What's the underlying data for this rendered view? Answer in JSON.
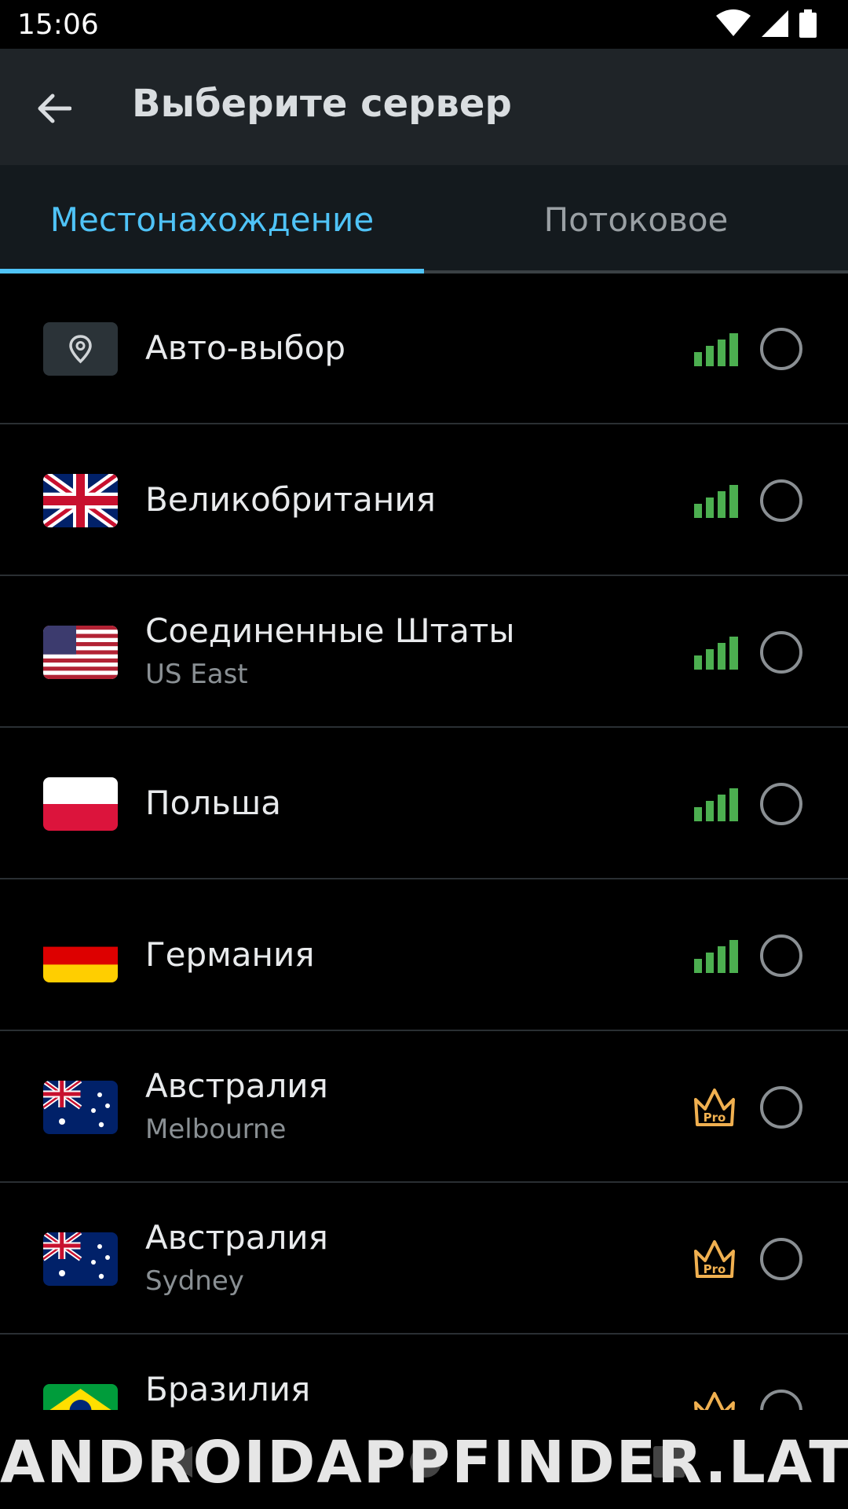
{
  "status_bar": {
    "time": "15:06"
  },
  "app_bar": {
    "title": "Выберите сервер"
  },
  "tabs": [
    {
      "label": "Местонахождение",
      "active": true
    },
    {
      "label": "Потоковое",
      "active": false
    }
  ],
  "servers": [
    {
      "name": "Авто-выбор",
      "sub": "",
      "icon": "location-pin-icon",
      "indicator": "signal"
    },
    {
      "name": "Великобритания",
      "sub": "",
      "icon": "uk-flag-icon",
      "indicator": "signal"
    },
    {
      "name": "Соединенные Штаты",
      "sub": "US East",
      "icon": "us-flag-icon",
      "indicator": "signal"
    },
    {
      "name": "Польша",
      "sub": "",
      "icon": "poland-flag-icon",
      "indicator": "signal"
    },
    {
      "name": "Германия",
      "sub": "",
      "icon": "germany-flag-icon",
      "indicator": "signal"
    },
    {
      "name": "Австралия",
      "sub": "Melbourne",
      "icon": "australia-flag-icon",
      "indicator": "pro"
    },
    {
      "name": "Австралия",
      "sub": "Sydney",
      "icon": "australia-flag-icon",
      "indicator": "pro"
    },
    {
      "name": "Бразилия",
      "sub": "",
      "icon": "brazil-flag-icon",
      "indicator": "pro"
    }
  ],
  "pro_badge": "Pro",
  "watermark": "ANDROIDAPPFINDER.LAT",
  "colors": {
    "accent": "#4fc3f7",
    "signal": "#4caf50",
    "pro": "#f0b050",
    "appbar": "#1f2428",
    "tabs": "#141a1e"
  }
}
